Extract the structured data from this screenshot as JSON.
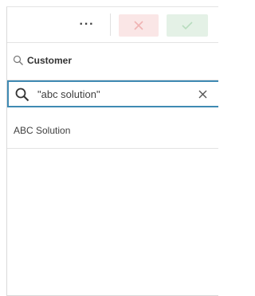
{
  "toolbar": {
    "more_label": "···",
    "colors": {
      "cancel_bg": "#fae6e6",
      "cancel_icon": "#f0b3b3",
      "confirm_bg": "#e4f1e6",
      "confirm_icon": "#b8dcbe"
    }
  },
  "field": {
    "title": "Customer",
    "icon": "lookup-icon"
  },
  "search": {
    "value": "\"abc solution\"",
    "icon": "search-icon",
    "clear_icon": "close-icon",
    "border_color": "#3f8ab3"
  },
  "results": [
    {
      "label": "ABC Solution"
    }
  ]
}
